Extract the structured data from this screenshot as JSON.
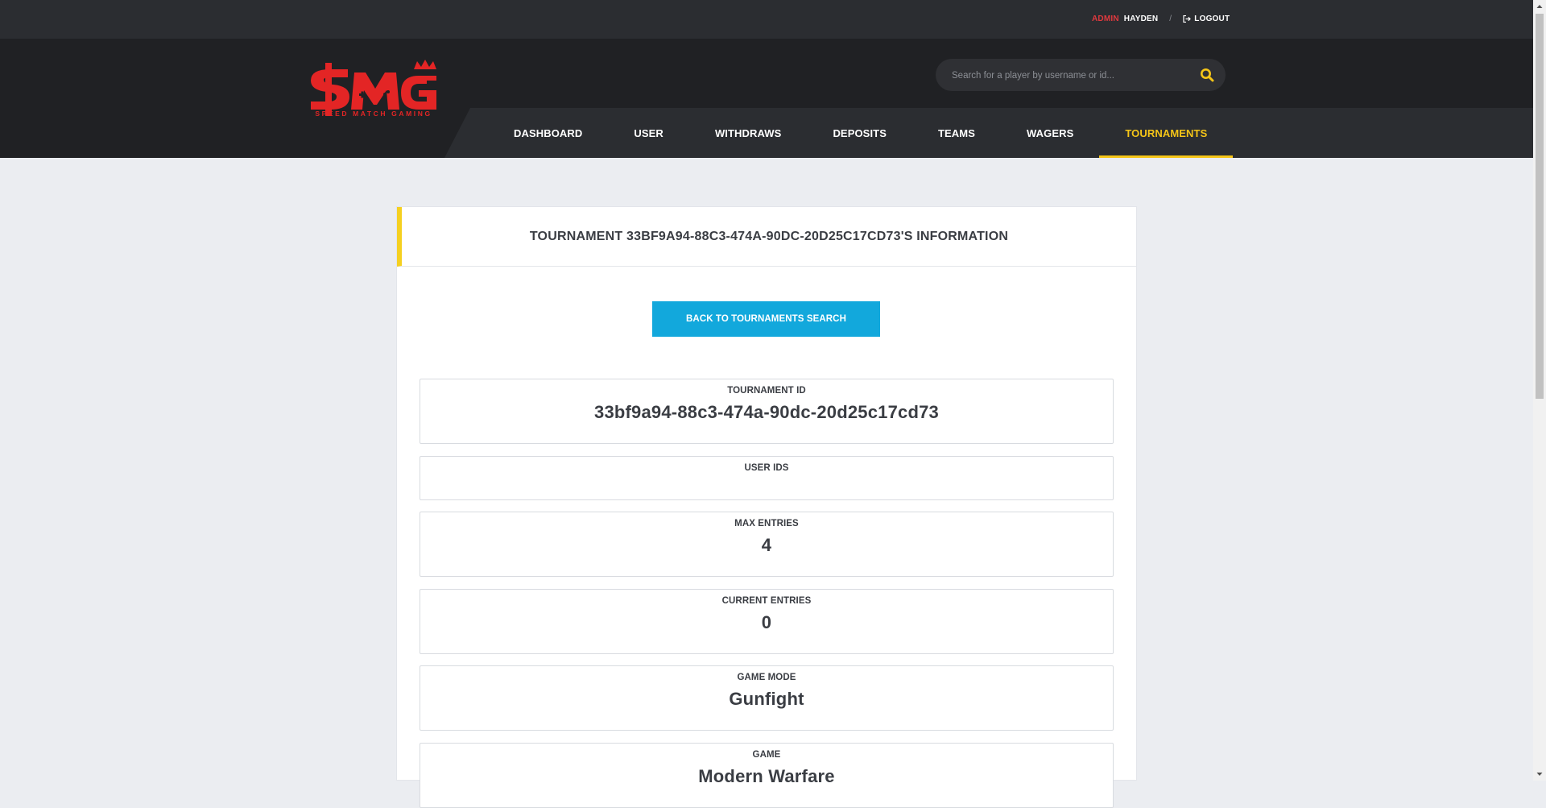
{
  "topbar": {
    "admin_tag": "ADMIN",
    "admin_name": "HAYDEN",
    "separator": "/",
    "logout_label": "LOGOUT"
  },
  "brand": {
    "logo_text": "$MG",
    "tagline": "SPEED MATCH GAMING"
  },
  "search": {
    "placeholder": "Search for a player by username or id...",
    "value": ""
  },
  "nav": {
    "items": [
      {
        "label": "DASHBOARD"
      },
      {
        "label": "USER"
      },
      {
        "label": "WITHDRAWS"
      },
      {
        "label": "DEPOSITS"
      },
      {
        "label": "TEAMS"
      },
      {
        "label": "WAGERS"
      },
      {
        "label": "TOURNAMENTS",
        "active": true
      }
    ]
  },
  "card": {
    "title": "TOURNAMENT 33BF9A94-88C3-474A-90DC-20D25C17CD73'S INFORMATION",
    "back_button_label": "BACK TO TOURNAMENTS SEARCH"
  },
  "fields": [
    {
      "label": "TOURNAMENT ID",
      "value": "33bf9a94-88c3-474a-90dc-20d25c17cd73"
    },
    {
      "label": "USER IDS",
      "value": ""
    },
    {
      "label": "MAX ENTRIES",
      "value": "4"
    },
    {
      "label": "CURRENT ENTRIES",
      "value": "0"
    },
    {
      "label": "GAME MODE",
      "value": "Gunfight"
    },
    {
      "label": "GAME",
      "value": "Modern Warfare"
    }
  ],
  "colors": {
    "accent_yellow": "#f5c518",
    "brand_red": "#e32525",
    "button_blue": "#12a8dc"
  }
}
